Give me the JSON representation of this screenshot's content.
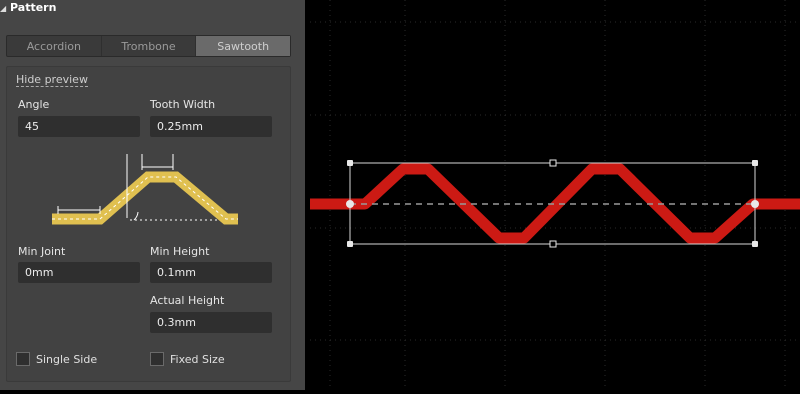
{
  "pattern": {
    "title": "Pattern",
    "segments": [
      "Accordion",
      "Trombone",
      "Sawtooth"
    ],
    "selected_segment": "Sawtooth",
    "hide_preview": "Hide preview",
    "angle": {
      "label": "Angle",
      "value": "45"
    },
    "tooth_width": {
      "label": "Tooth Width",
      "value": "0.25mm"
    },
    "min_joint": {
      "label": "Min Joint",
      "value": "0mm"
    },
    "min_height": {
      "label": "Min Height",
      "value": "0.1mm"
    },
    "actual_height": {
      "label": "Actual Height",
      "value": "0.3mm"
    },
    "single_side": {
      "label": "Single Side",
      "checked": false
    },
    "fixed_size": {
      "label": "Fixed Size",
      "checked": false
    }
  },
  "colors": {
    "panel_bg": "#464646",
    "trace_red": "#cc1a14",
    "preview_yellow": "#e0c050",
    "canvas_bg": "#000000"
  }
}
